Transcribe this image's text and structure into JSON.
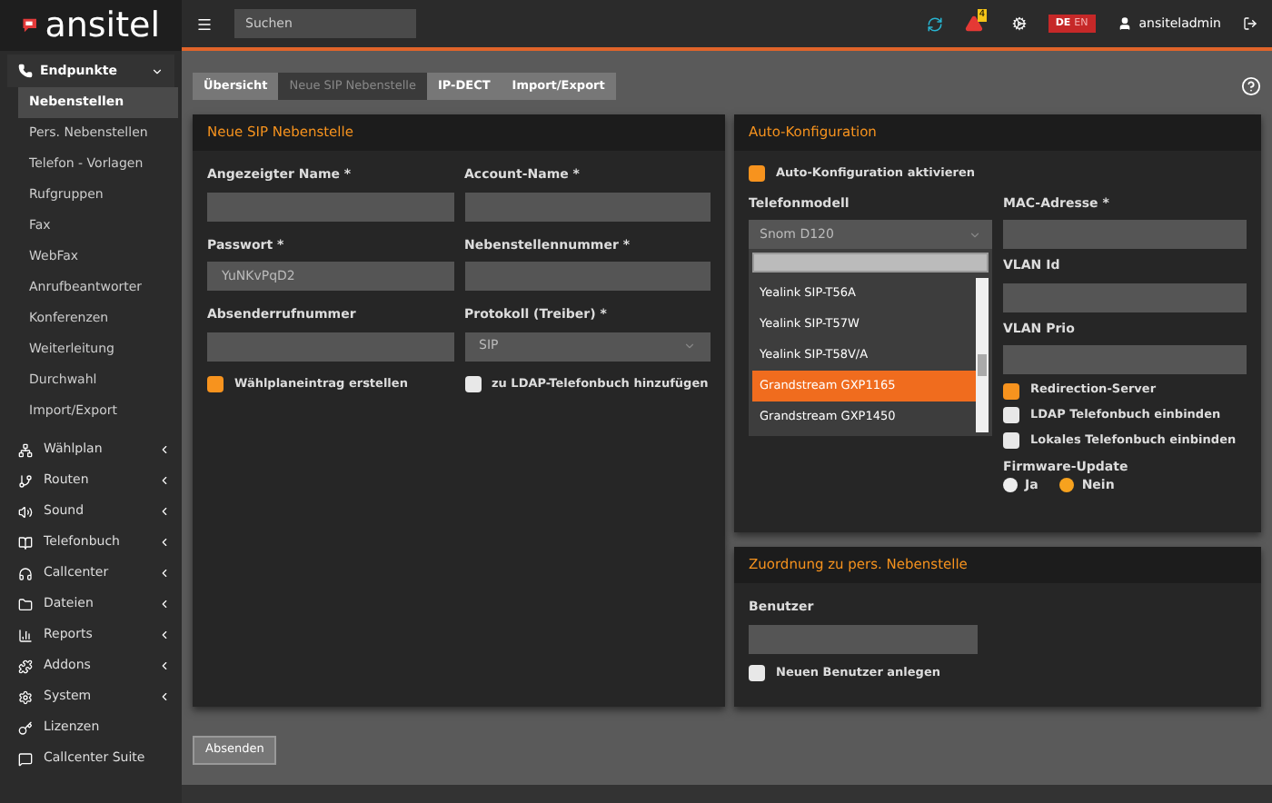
{
  "logo": {
    "text": "ansitel"
  },
  "topbar": {
    "search_placeholder": "Suchen",
    "language": [
      {
        "label": "DE",
        "selected": true
      },
      {
        "label": "EN",
        "selected": false
      }
    ],
    "user": "ansiteladmin",
    "alert_count": "4"
  },
  "sidebar": {
    "section": {
      "label": "Endpunkte",
      "expanded": true,
      "items": [
        {
          "label": "Nebenstellen",
          "selected": true
        },
        {
          "label": "Pers. Nebenstellen",
          "selected": false
        },
        {
          "label": "Telefon - Vorlagen",
          "selected": false
        },
        {
          "label": "Rufgruppen",
          "selected": false
        },
        {
          "label": "Fax",
          "selected": false
        },
        {
          "label": "WebFax",
          "selected": false
        },
        {
          "label": "Anrufbeantworter",
          "selected": false
        },
        {
          "label": "Konferenzen",
          "selected": false
        },
        {
          "label": "Weiterleitung",
          "selected": false
        },
        {
          "label": "Durchwahl",
          "selected": false
        },
        {
          "label": "Import/Export",
          "selected": false
        }
      ]
    },
    "groups": [
      {
        "label": "Wählplan",
        "has_children": true
      },
      {
        "label": "Routen",
        "has_children": true
      },
      {
        "label": "Sound",
        "has_children": true
      },
      {
        "label": "Telefonbuch",
        "has_children": true
      },
      {
        "label": "Callcenter",
        "has_children": true
      },
      {
        "label": "Dateien",
        "has_children": true
      },
      {
        "label": "Reports",
        "has_children": true
      },
      {
        "label": "Addons",
        "has_children": true
      },
      {
        "label": "System",
        "has_children": true
      },
      {
        "label": "Lizenzen",
        "has_children": false
      },
      {
        "label": "Callcenter Suite",
        "has_children": false
      }
    ]
  },
  "tabs": [
    {
      "label": "Übersicht",
      "selected": false
    },
    {
      "label": "Neue SIP Nebenstelle",
      "selected": true
    },
    {
      "label": "IP-DECT",
      "selected": false
    },
    {
      "label": "Import/Export",
      "selected": false
    }
  ],
  "sip_panel": {
    "title": "Neue SIP Nebenstelle",
    "fields": [
      {
        "label": "Angezeigter Name *"
      },
      {
        "label": "Account-Name *"
      },
      {
        "label": "Passwort *",
        "value": "YuNKvPqD2"
      },
      {
        "label": "Nebenstellennummer *"
      },
      {
        "label": "Absenderrufnummer"
      },
      {
        "label": "Protokoll (Treiber) *",
        "value": "SIP",
        "kind": "select"
      }
    ],
    "checkboxes": [
      {
        "label": "Wählplaneintrag erstellen",
        "checked": true
      },
      {
        "label": "zu LDAP-Telefonbuch hinzufügen",
        "checked": false
      }
    ]
  },
  "auto_config": {
    "title": "Auto-Konfiguration",
    "enable": {
      "label": "Auto-Konfiguration aktivieren",
      "checked": true
    },
    "phone_model": {
      "label": "Telefonmodell",
      "value": "Snom D120",
      "options": [
        {
          "label": "Yealink SIP-T56A",
          "selected": false
        },
        {
          "label": "Yealink SIP-T57W",
          "selected": false
        },
        {
          "label": "Yealink SIP-T58V/A",
          "selected": false
        },
        {
          "label": "Grandstream GXP1165",
          "selected": true
        },
        {
          "label": "Grandstream GXP1450",
          "selected": false
        }
      ]
    },
    "fields": [
      {
        "label": "MAC-Adresse *"
      },
      {
        "label": "VLAN Id"
      },
      {
        "label": "VLAN Prio"
      }
    ],
    "checkboxes": [
      {
        "label": "Redirection-Server",
        "checked": true
      },
      {
        "label": "LDAP Telefonbuch einbinden",
        "checked": false
      },
      {
        "label": "Lokales Telefonbuch einbinden",
        "checked": false
      }
    ],
    "firmware": {
      "label": "Firmware-Update",
      "options": [
        {
          "label": "Ja",
          "selected": false
        },
        {
          "label": "Nein",
          "selected": true
        }
      ]
    }
  },
  "assignment": {
    "title": "Zuordnung zu pers. Nebenstelle",
    "field": {
      "label": "Benutzer"
    },
    "checkbox": {
      "label": "Neuen Benutzer anlegen",
      "checked": false
    }
  },
  "submit": "Absenden"
}
